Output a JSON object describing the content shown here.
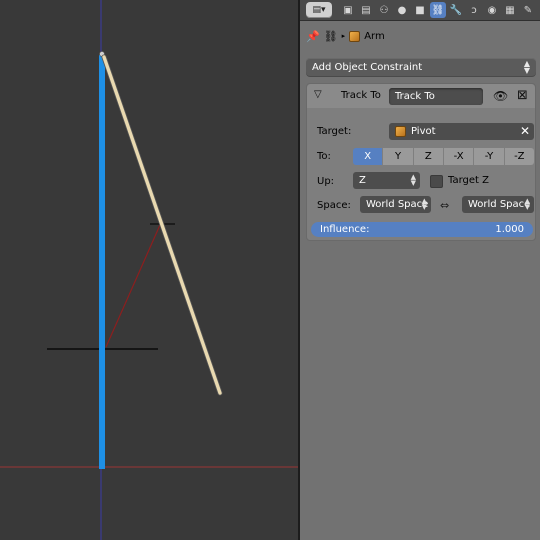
{
  "header": {
    "editor_type_icon": "properties-editor-icon",
    "tabs": [
      {
        "icon": "render-icon",
        "glyph": "▣",
        "active": false
      },
      {
        "icon": "render-layers-icon",
        "glyph": "▤",
        "active": false
      },
      {
        "icon": "scene-icon",
        "glyph": "⚇",
        "active": false
      },
      {
        "icon": "world-icon",
        "glyph": "●",
        "active": false
      },
      {
        "icon": "object-icon",
        "glyph": "■",
        "active": false
      },
      {
        "icon": "object-constraint-icon",
        "glyph": "⛓",
        "active": true
      },
      {
        "icon": "modifier-icon",
        "glyph": "🔧",
        "active": false
      },
      {
        "icon": "particles-icon",
        "glyph": "ↄ",
        "active": false
      },
      {
        "icon": "material-icon",
        "glyph": "◉",
        "active": false
      },
      {
        "icon": "texture-icon",
        "glyph": "▦",
        "active": false
      },
      {
        "icon": "physics-icon",
        "glyph": "✎",
        "active": false
      }
    ]
  },
  "breadcrumb": {
    "pin_icon": "pin-icon",
    "object_icon": "object-icon",
    "object_name": "Arm"
  },
  "add_constraint": {
    "label": "Add Object Constraint"
  },
  "constraint": {
    "type_label": "Track To",
    "name": "Track To",
    "target_label": "Target:",
    "target_value": "Pivot",
    "to_label": "To:",
    "axes": [
      "X",
      "Y",
      "Z",
      "-X",
      "-Y",
      "-Z"
    ],
    "active_axis": "X",
    "up_label": "Up:",
    "up_value": "Z",
    "target_z_label": "Target Z",
    "target_z_checked": false,
    "space_label": "Space:",
    "owner_space": "World Space",
    "target_space": "World Space",
    "influence_label": "Influence:",
    "influence_value": "1.000"
  },
  "colors": {
    "accent": "#5680c2",
    "viewport_bg": "#393939",
    "panel_bg": "#727272",
    "bone_selected": "#1e90e6",
    "bone_deselected": "#e9d9b0"
  }
}
